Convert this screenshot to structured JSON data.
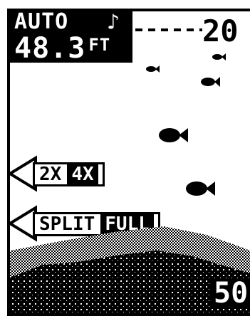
{
  "display": {
    "mode": "AUTO",
    "alarm_symbol": "♪",
    "depth": "48.3",
    "depth_unit": "FT",
    "range_top": "20",
    "range_bottom": "50"
  },
  "zoom_selector": {
    "options": [
      "2X",
      "4X"
    ],
    "selected": "4X"
  },
  "view_selector": {
    "options": [
      "SPLIT",
      "FULL"
    ],
    "selected": "FULL"
  },
  "colors": {
    "lcd_background": "#ffffff",
    "pixels": "#000000"
  },
  "icons": [
    "fish-icon",
    "zoom-arrow-icon",
    "split-arrow-icon",
    "bottom-contour"
  ]
}
